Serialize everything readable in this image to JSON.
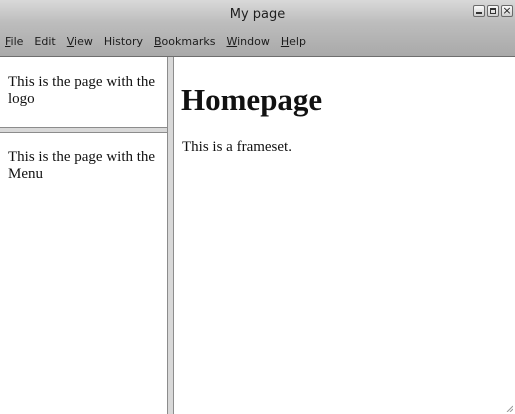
{
  "window": {
    "title": "My page"
  },
  "window_controls": {
    "minimize_icon": "minimize-icon",
    "maximize_icon": "maximize-icon",
    "close_icon": "close-icon",
    "close_glyph": "×"
  },
  "menubar": {
    "items": [
      {
        "mnemonic": "F",
        "rest": "ile"
      },
      {
        "mnemonic": "",
        "rest": "Edit"
      },
      {
        "mnemonic": "V",
        "rest": "iew"
      },
      {
        "mnemonic": "",
        "rest": "History"
      },
      {
        "mnemonic": "B",
        "rest": "ookmarks"
      },
      {
        "mnemonic": "W",
        "rest": "indow"
      },
      {
        "mnemonic": "H",
        "rest": "elp"
      }
    ]
  },
  "frames": {
    "logo_frame_text": "This is the page with the logo",
    "menu_frame_text": "This is the page with the Menu",
    "main_heading": "Homepage",
    "main_text": "This is a frameset."
  }
}
